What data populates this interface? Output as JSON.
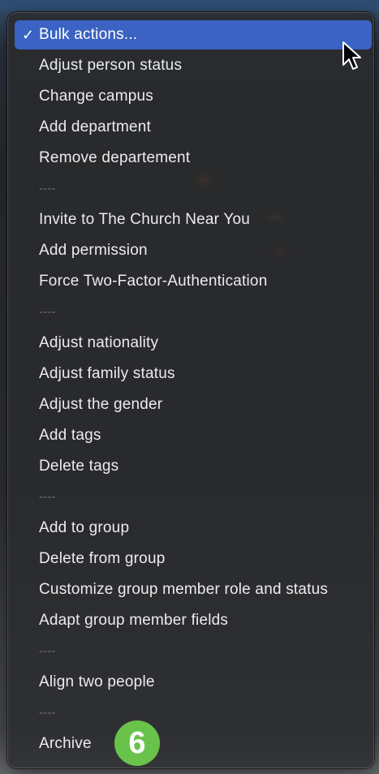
{
  "menu": {
    "selected_item": "Bulk actions...",
    "checkmark": "✓",
    "items": [
      "Adjust person status",
      "Change campus",
      "Add department",
      "Remove departement",
      "----",
      "Invite to The Church Near You",
      "Add permission",
      "Force Two-Factor-Authentication",
      "----",
      "Adjust nationality",
      "Adjust family status",
      "Adjust the gender",
      "Add tags",
      "Delete tags",
      "----",
      "Add to group",
      "Delete from group",
      "Customize group member role and status",
      "Adapt group member fields",
      "----",
      "Align two people",
      "----",
      "Archive"
    ]
  },
  "badge": {
    "number": "6",
    "color": "#69c24a"
  },
  "colors": {
    "selection": "#3a63c3",
    "menu_text": "#ececee",
    "separator_text": "#6d6e72"
  },
  "icons": {
    "pointer": "mouse-pointer-icon",
    "check": "checkmark-icon"
  }
}
